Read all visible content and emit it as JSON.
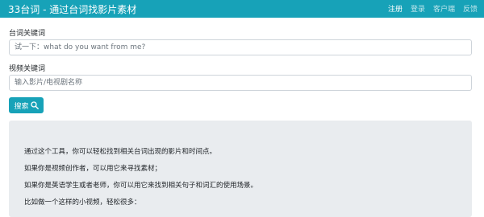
{
  "header": {
    "brand": "33台词 - 通过台词找影片素材",
    "nav": [
      "注册",
      "登录",
      "客户端",
      "反馈"
    ]
  },
  "form": {
    "quote_label": "台词关键词",
    "quote_placeholder": "试一下：what do you want from me?",
    "video_label": "视频关键词",
    "video_placeholder": "输入影片/电视剧名称",
    "search_label": "搜索",
    "search_icon": "search-icon"
  },
  "intro": {
    "lines": [
      "通过这个工具，你可以轻松找到相关台词出现的影片和时间点。",
      "如果你是视频创作者，可以用它来寻找素材；",
      "如果你是英语学生或者老师，你可以用它来找到相关句子和词汇的使用场景。",
      "比如做一个这样的小视频，轻松很多："
    ]
  },
  "colors": {
    "accent": "#17a2b8",
    "panel": "#e9ecef"
  }
}
